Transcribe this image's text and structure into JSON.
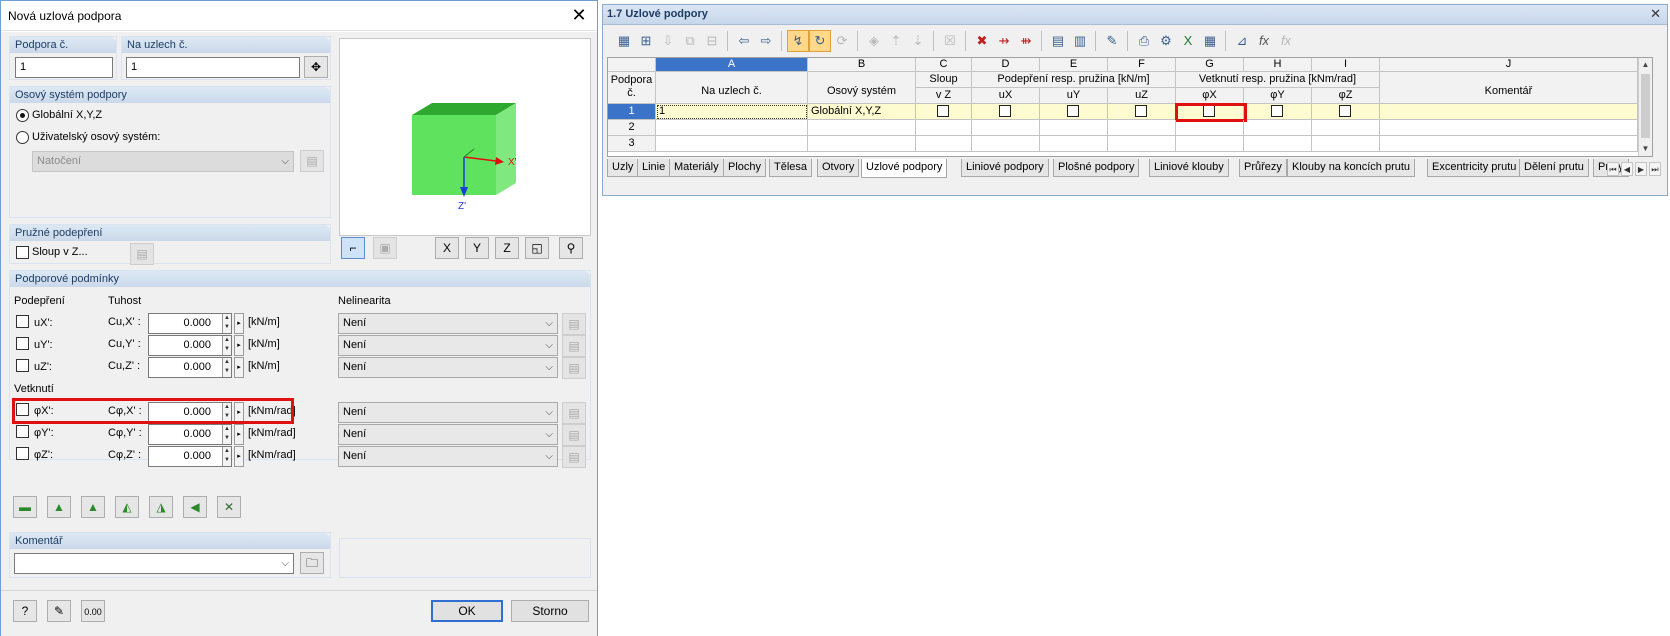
{
  "dialog": {
    "title": "Nová uzlová podpora",
    "support_no": {
      "label": "Podpora č.",
      "value": "1"
    },
    "nodes": {
      "label": "Na uzlech č.",
      "value": "1"
    },
    "axis_section": {
      "title": "Osový systém podpory",
      "global_label": "Globální X,Y,Z",
      "user_label": "Uživatelský osový systém:",
      "rotation_placeholder": "Natočení"
    },
    "elastic_section": {
      "title": "Pružné podepření",
      "column_label": "Sloup v Z..."
    },
    "conditions": {
      "title": "Podporové podmínky",
      "col_support": "Podepření",
      "col_stiffness": "Tuhost",
      "col_nonlinearity": "Nelinearita",
      "fixity_title": "Vetknutí",
      "rows": [
        {
          "label": "uX':",
          "coef": "Cu,X' :",
          "value": "0.000",
          "unit": "[kN/m]",
          "nonlin": "Není"
        },
        {
          "label": "uY':",
          "coef": "Cu,Y' :",
          "value": "0.000",
          "unit": "[kN/m]",
          "nonlin": "Není"
        },
        {
          "label": "uZ':",
          "coef": "Cu,Z' :",
          "value": "0.000",
          "unit": "[kN/m]",
          "nonlin": "Není"
        },
        {
          "label": "φX':",
          "coef": "Cφ,X' :",
          "value": "0.000",
          "unit": "[kNm/rad]",
          "nonlin": "Není"
        },
        {
          "label": "φY':",
          "coef": "Cφ,Y' :",
          "value": "0.000",
          "unit": "[kNm/rad]",
          "nonlin": "Není"
        },
        {
          "label": "φZ':",
          "coef": "Cφ,Z' :",
          "value": "0.000",
          "unit": "[kNm/rad]",
          "nonlin": "Není"
        }
      ]
    },
    "comment_section": {
      "title": "Komentář",
      "value": ""
    },
    "preview": {
      "x_axis": "X'",
      "z_axis": "Z'"
    },
    "ok_label": "OK",
    "cancel_label": "Storno"
  },
  "table": {
    "title": "1.7 Uzlové podpory",
    "columns": [
      "A",
      "B",
      "C",
      "D",
      "E",
      "F",
      "G",
      "H",
      "I",
      "J"
    ],
    "headers": {
      "row_header": "Podpora č.",
      "node": "Na uzlech č.",
      "axis": "Osový systém",
      "column_top": "Sloup",
      "column_bottom": "v Z",
      "support_group": "Podepření resp. pružina [kN/m]",
      "fixity_group": "Vetknutí resp. pružina [kNm/rad]",
      "ux": "uX",
      "uy": "uY",
      "uz": "uZ",
      "phx": "φX",
      "phy": "φY",
      "phz": "φZ",
      "comment": "Komentář"
    },
    "rows": [
      {
        "no": "1",
        "node": "1",
        "axis": "Globální X,Y,Z"
      },
      {
        "no": "2",
        "node": "",
        "axis": ""
      },
      {
        "no": "3",
        "node": "",
        "axis": ""
      }
    ],
    "tabs": [
      "Uzly",
      "Linie",
      "Materiály",
      "Plochy",
      "Tělesa",
      "Otvory",
      "Uzlové podpory",
      "Liniové podpory",
      "Plošné podpory",
      "Liniové klouby",
      "Průřezy",
      "Klouby na koncích prutu",
      "Excentricity prutu",
      "Dělení prutu",
      "Pruty"
    ],
    "active_tab": "Uzlové podpory"
  },
  "colors": {
    "accent": "#3b73c8",
    "highlight": "#e01010",
    "row_active": "#fffbd0",
    "cube": "#5fe35f"
  }
}
